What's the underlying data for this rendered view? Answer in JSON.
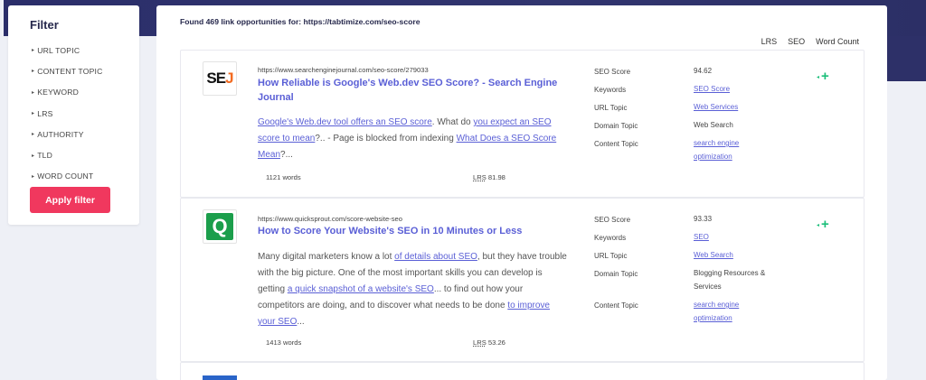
{
  "sidebar": {
    "title": "Filter",
    "items": [
      {
        "label": "URL TOPIC"
      },
      {
        "label": "CONTENT TOPIC"
      },
      {
        "label": "KEYWORD"
      },
      {
        "label": "LRS"
      },
      {
        "label": "AUTHORITY"
      },
      {
        "label": "TLD"
      },
      {
        "label": "WORD COUNT"
      }
    ],
    "apply_label": "Apply filter"
  },
  "main": {
    "found_text": "Found 469 link opportunities for: https://tabtimize.com/seo-score",
    "sort": [
      "LRS",
      "SEO",
      "Word Count"
    ]
  },
  "results": [
    {
      "logo": "SEJ",
      "url": "https://www.searchenginejournal.com/seo-score/279033",
      "title": "How Reliable is Google's Web.dev SEO Score? - Search Engine Journal",
      "snippet": {
        "l1": "Google's Web.dev tool offers an SEO score",
        "t1": ". What do ",
        "l2": "you expect an SEO score to mean",
        "t2": "?.. - Page is blocked from indexing ",
        "l3": "What Does a SEO Score Mean",
        "t3": "?..."
      },
      "words": "1121 words",
      "lrs_label": "LRS",
      "lrs_value": "81.98",
      "meta": {
        "seo_score_label": "SEO Score",
        "seo_score": "94.62",
        "keywords_label": "Keywords",
        "keywords": "SEO Score",
        "url_topic_label": "URL Topic",
        "url_topic": "Web Services",
        "domain_topic_label": "Domain Topic",
        "domain_topic": "Web Search",
        "content_topic_label": "Content Topic",
        "content_topic": "search engine optimization"
      }
    },
    {
      "logo": "Q",
      "url": "https://www.quicksprout.com/score-website-seo",
      "title": "How to Score Your Website's SEO in 10 Minutes or Less",
      "snippet": {
        "t0": "Many digital marketers know a lot ",
        "l1": "of details about SEO",
        "t1": ", but they have trouble with the big picture. One of the most important skills you can develop is getting ",
        "l2": "a quick snapshot of a website's SEO",
        "t2": "... to find out how your competitors are doing, and to discover what needs to be done ",
        "l3": "to improve your SEO",
        "t3": "..."
      },
      "words": "1413 words",
      "lrs_label": "LRS",
      "lrs_value": "53.26",
      "meta": {
        "seo_score_label": "SEO Score",
        "seo_score": "93.33",
        "keywords_label": "Keywords",
        "keywords": "SEO",
        "url_topic_label": "URL Topic",
        "url_topic": "Web Search",
        "domain_topic_label": "Domain Topic",
        "domain_topic": "Blogging Resources & Services",
        "content_topic_label": "Content Topic",
        "content_topic": "search engine optimization"
      }
    }
  ],
  "icons": {
    "caret": "▸",
    "expand": "◂",
    "add": "+"
  },
  "colors": {
    "accent": "#5a5fd6",
    "apply": "#f0385e",
    "add": "#1cbf7a",
    "header": "#2b2e6a"
  }
}
